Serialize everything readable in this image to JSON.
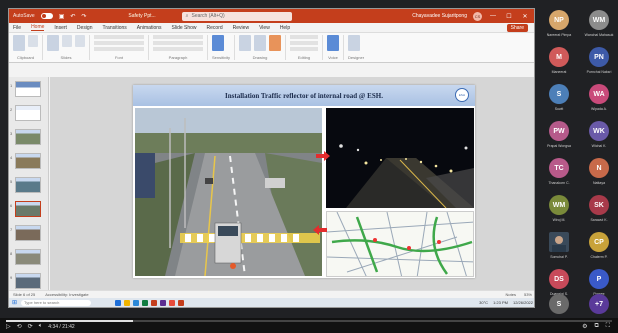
{
  "window": {
    "autosave": "AutoSave",
    "doc_title": "Safety Ppt...",
    "search_placeholder": "Search (Alt+Q)",
    "user": "Chayavadee Sujaritpong",
    "user_initials": "CS",
    "min": "—",
    "max": "☐",
    "close": "✕"
  },
  "menubar": {
    "items": [
      "File",
      "Home",
      "Insert",
      "Design",
      "Transitions",
      "Animations",
      "Slide Show",
      "Record",
      "Review",
      "View",
      "Help"
    ],
    "active": "Home",
    "share": "Share"
  },
  "ribbon": {
    "groups": [
      "Clipboard",
      "Slides",
      "Font",
      "Paragraph",
      "Sensitivity",
      "Drawing",
      "Editing",
      "Voice",
      "Designer"
    ]
  },
  "thumbnails": [
    1,
    2,
    3,
    4,
    5,
    6,
    7,
    8,
    9
  ],
  "selected_slide": 6,
  "slide": {
    "title": "Installation Traffic reflector of internal road @ ESH.",
    "logo": "ESH"
  },
  "statusbar": {
    "slide_info": "Slide 6 of 25",
    "accessibility": "Accessibility: Investigate",
    "notes": "Notes",
    "zoom": "53%"
  },
  "taskbar": {
    "search_placeholder": "Type here to search",
    "weather": "30°C",
    "time": "1:23 PM",
    "date": "12/26/2022",
    "app_colors": [
      "#1e6fd9",
      "#f0b400",
      "#2b88d8",
      "#107c41",
      "#c43e1c",
      "#5c2d91",
      "#e74c3c",
      "#c43e1c"
    ]
  },
  "participants": [
    {
      "initials": "NP",
      "name": "Nareerat Pimpa",
      "color": "#d6a66b"
    },
    {
      "initials": "WM",
      "name": "Wanchai Mahasuk",
      "color": "#8c8c8c"
    },
    {
      "initials": "M",
      "name": "Maneerat",
      "color": "#d05a5a"
    },
    {
      "initials": "PN",
      "name": "Pornchai Naksri",
      "color": "#3d5aa8"
    },
    {
      "initials": "S",
      "name": "Suwit",
      "color": "#4c7fb8"
    },
    {
      "initials": "WA",
      "name": "Wipada A.",
      "color": "#c94a7a"
    },
    {
      "initials": "PW",
      "name": "Prapai Wongsa",
      "color": "#b55a8a"
    },
    {
      "initials": "WK",
      "name": "Wichai K.",
      "color": "#6a5aa8"
    },
    {
      "initials": "TC",
      "name": "Thanakorn C.",
      "color": "#b85a8a"
    },
    {
      "initials": "N",
      "name": "Nattaya",
      "color": "#c86a4a"
    },
    {
      "initials": "WM",
      "name": "Wiroj M.",
      "color": "#7a8a3a"
    },
    {
      "initials": "SK",
      "name": "Sarawut K.",
      "color": "#a83a4a"
    },
    {
      "initials": "",
      "name": "Somchai P.",
      "color": "#3a4a5a",
      "video": true
    },
    {
      "initials": "CP",
      "name": "Chalerm P.",
      "color": "#c8a23a"
    },
    {
      "initials": "DS",
      "name": "Duangjai S.",
      "color": "#c84a5a"
    },
    {
      "initials": "P",
      "name": "Pranee",
      "color": "#3a5ac8"
    },
    {
      "initials": "S",
      "name": "Supachai",
      "color": "#6a6a6a"
    },
    {
      "initials": "+7",
      "name": "",
      "color": "#5a3a9a"
    }
  ],
  "video": {
    "current": "4:34",
    "total": "21:42",
    "time_label": "4:34 / 21:42",
    "progress": 0.21
  }
}
